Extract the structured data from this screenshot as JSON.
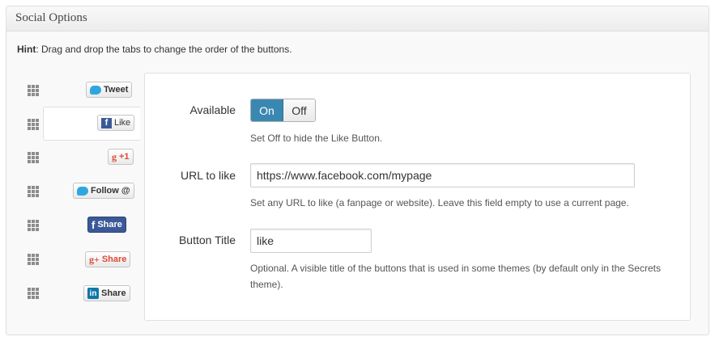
{
  "postbox": {
    "title": "Social Options"
  },
  "hint": {
    "label": "Hint",
    "text": ": Drag and drop the tabs to change the order of the buttons."
  },
  "tabs": [
    {
      "id": "twitter-tweet",
      "label": "Tweet",
      "icon": "twitter-bird-icon"
    },
    {
      "id": "facebook-like",
      "label": "Like",
      "icon": "facebook-f-icon",
      "active": true
    },
    {
      "id": "google-plus-one",
      "label": "+1",
      "icon": "google-g-icon"
    },
    {
      "id": "twitter-follow",
      "label": "Follow @",
      "icon": "twitter-bird-icon"
    },
    {
      "id": "facebook-share",
      "label": "Share",
      "icon": "facebook-f-icon"
    },
    {
      "id": "google-share",
      "label": "Share",
      "icon": "google-plus-icon"
    },
    {
      "id": "linkedin-share",
      "label": "Share",
      "icon": "linkedin-in-icon"
    }
  ],
  "icon_text": {
    "facebook": "f",
    "google": "g",
    "google_plus": "g+",
    "linkedin": "in"
  },
  "settings": {
    "available": {
      "label": "Available",
      "on_label": "On",
      "off_label": "Off",
      "selected": "On",
      "description": "Set Off to hide the Like Button."
    },
    "url": {
      "label": "URL to like",
      "value": "https://www.facebook.com/mypage",
      "description": "Set any URL to like (a fanpage or website). Leave this field empty to use a current page."
    },
    "button_title": {
      "label": "Button Title",
      "value": "like",
      "description_line1": "Optional. A visible title of the buttons that is used in some themes (by default only in the Secrets",
      "description_line2": "theme)."
    }
  },
  "colors": {
    "accent": "#3a88b1",
    "facebook": "#3b5998",
    "twitter": "#2ea7e0",
    "google": "#dd4b39",
    "linkedin": "#0e76a8"
  }
}
